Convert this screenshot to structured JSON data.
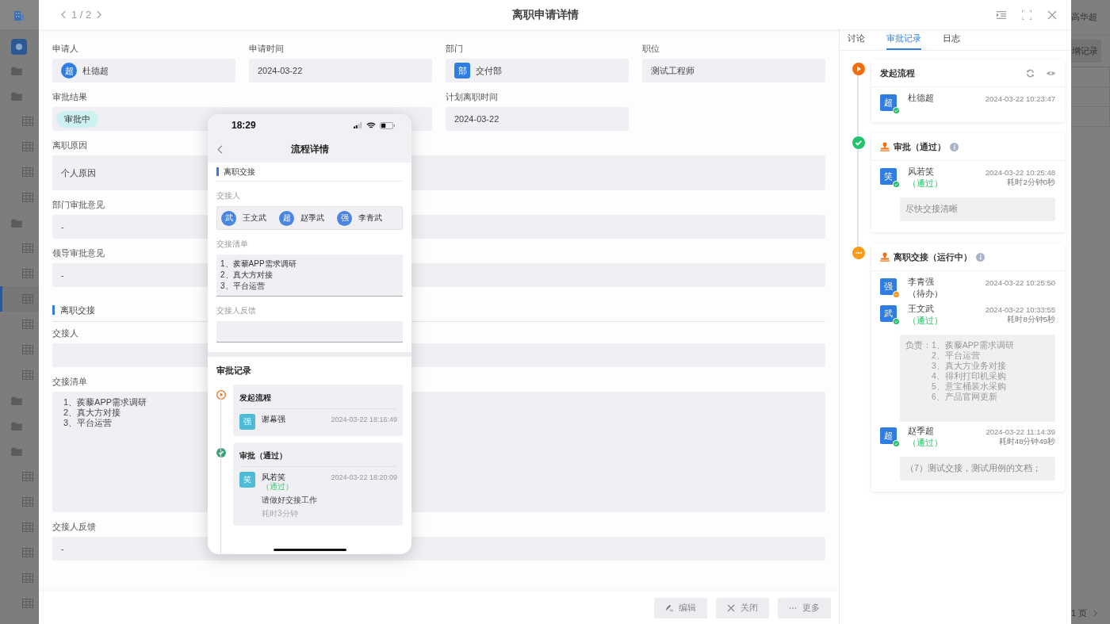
{
  "background": {
    "sidebar": [
      {
        "kind": "app",
        "selected": false
      },
      {
        "kind": "folder",
        "selected": false
      },
      {
        "kind": "folder",
        "selected": false
      },
      {
        "kind": "table",
        "selected": false
      },
      {
        "kind": "table",
        "selected": false
      },
      {
        "kind": "table",
        "selected": false
      },
      {
        "kind": "table",
        "selected": false
      },
      {
        "kind": "folder",
        "selected": false
      },
      {
        "kind": "table",
        "selected": false
      },
      {
        "kind": "table",
        "selected": false
      },
      {
        "kind": "table",
        "selected": true
      },
      {
        "kind": "table",
        "selected": false
      },
      {
        "kind": "table",
        "selected": false
      },
      {
        "kind": "table",
        "selected": false
      },
      {
        "kind": "folder",
        "selected": false
      },
      {
        "kind": "folder",
        "selected": false
      },
      {
        "kind": "folder",
        "selected": false
      },
      {
        "kind": "table",
        "selected": false
      },
      {
        "kind": "table",
        "selected": false
      },
      {
        "kind": "table",
        "selected": false
      },
      {
        "kind": "table",
        "selected": false
      },
      {
        "kind": "table",
        "selected": false
      },
      {
        "kind": "table",
        "selected": false
      }
    ],
    "user_name": "高华超",
    "add_button": "增记录",
    "pager": "1 页"
  },
  "dialog": {
    "pager": "1 / 2",
    "title": "离职申请详情"
  },
  "form": {
    "rows": [
      [
        {
          "kind": "person",
          "label": "申请人",
          "avatar": "超",
          "value": "杜德超"
        },
        {
          "kind": "text",
          "label": "申请时间",
          "value": "2024-03-22"
        },
        {
          "kind": "department",
          "label": "部门",
          "avatar": "部",
          "value": "交付部"
        },
        {
          "kind": "text",
          "label": "职位",
          "value": "测试工程师"
        }
      ],
      [
        {
          "kind": "tag",
          "label": "审批结果",
          "value": "审批中"
        },
        "",
        {
          "kind": "text",
          "label": "计划离职时间",
          "value": "2024-03-22"
        }
      ],
      [
        {
          "kind": "paragraph",
          "label": "离职原因",
          "value": "个人原因"
        }
      ],
      [
        {
          "kind": "text",
          "label": "部门审批意见",
          "value": "-"
        }
      ],
      [
        {
          "kind": "text",
          "label": "领导审批意见",
          "value": "-"
        }
      ]
    ],
    "section_title": "离职交接",
    "handover_fields": [
      {
        "kind": "text",
        "label": "交接人"
      },
      {
        "kind": "textarea",
        "label": "交接清单",
        "lines": [
          "1、蒺藜APP需求调研",
          "2、真大方对接",
          "3、平台运营"
        ]
      },
      {
        "kind": "text",
        "label": "交接人反馈",
        "value": "-"
      }
    ]
  },
  "footer_buttons": [
    {
      "kind": "edit",
      "label": "编辑"
    },
    {
      "kind": "close",
      "label": "关闭"
    },
    {
      "kind": "more",
      "label": "更多"
    }
  ],
  "side_panel": {
    "tabs": [
      {
        "label": "讨论",
        "selected": false
      },
      {
        "label": "审批记录",
        "selected": true
      },
      {
        "label": "日志",
        "selected": false
      }
    ],
    "timeline": [
      {
        "kind": "start",
        "title": "发起流程",
        "entries": [
          {
            "avatar": "超",
            "name": "杜德超",
            "done": true,
            "time": "2024-03-22 10:23:47"
          }
        ]
      },
      {
        "kind": "approved",
        "title": "审批（通过）",
        "entries": [
          {
            "avatar": "笑",
            "name": "风若笑",
            "done": true,
            "result": "（通过）",
            "time": "2024-03-22 10:25:48",
            "duration": "耗时2分钟0秒",
            "comment": "尽快交接清晰"
          }
        ]
      },
      {
        "kind": "running",
        "title": "离职交接（运行中）",
        "entries": [
          {
            "avatar": "强",
            "name": "李青强",
            "done": false,
            "result": "（待办）",
            "time": "2024-03-22 10:25:50"
          },
          {
            "avatar": "武",
            "name": "王文武",
            "done": true,
            "result": "（通过）",
            "time": "2024-03-22 10:33:55",
            "duration": "耗时8分钟5秒",
            "comment_label": "负责：",
            "comment_lines": [
              "1、蒺藜APP需求调研",
              "2、平台运营",
              "3、真大方业务对接",
              "4、得利打印机采购",
              "5、意宝桶装水采购",
              "6、产品官网更新"
            ]
          },
          {
            "avatar": "超",
            "name": "赵季超",
            "done": true,
            "result": "（通过）",
            "time": "2024-03-22 11:14:39",
            "duration": "耗时48分钟49秒",
            "comment": "（7）测试交接，测试用例的文档；"
          }
        ]
      }
    ]
  },
  "phone_preview": {
    "time": "18:29",
    "title": "流程详情",
    "section": "离职交接",
    "handover_label": "交接人",
    "handovers": [
      {
        "avatar": "武",
        "name": "王文武"
      },
      {
        "avatar": "超",
        "name": "赵季武"
      },
      {
        "avatar": "强",
        "name": "李青武"
      }
    ],
    "list_label": "交接清单",
    "list_lines": [
      "1、蒺藜APP需求调研",
      "2、真大方对接",
      "3、平台运营"
    ],
    "feedback_label": "交接人反馈",
    "records_title": "审批记录",
    "records": [
      {
        "kind": "start",
        "title": "发起流程",
        "avatar": "强",
        "name": "谢幕强",
        "time": "2024-03-22 18:16:49"
      },
      {
        "kind": "approved",
        "title": "审批（通过）",
        "avatar": "笑",
        "name": "风若笑",
        "result": "（通过）",
        "time": "2024-03-22 18:20:09",
        "comment": "请做好交接工作",
        "duration": "耗时3分钟"
      }
    ]
  }
}
